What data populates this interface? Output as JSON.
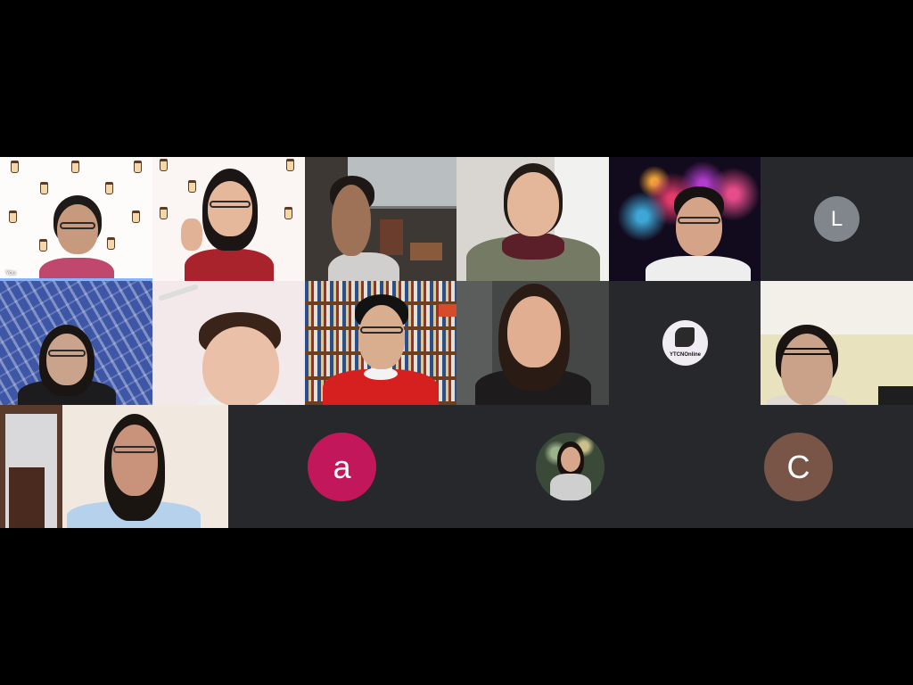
{
  "meeting": {
    "self_label": "You",
    "participants": [
      {
        "id": "p1",
        "kind": "video",
        "is_self": true
      },
      {
        "id": "p2",
        "kind": "video"
      },
      {
        "id": "p3",
        "kind": "video"
      },
      {
        "id": "p4",
        "kind": "video"
      },
      {
        "id": "p5",
        "kind": "video"
      },
      {
        "id": "p6",
        "kind": "avatar",
        "initial": "L",
        "color": "#80868b"
      },
      {
        "id": "p7",
        "kind": "video"
      },
      {
        "id": "p8",
        "kind": "video"
      },
      {
        "id": "p9",
        "kind": "video"
      },
      {
        "id": "p10",
        "kind": "video"
      },
      {
        "id": "p11",
        "kind": "avatar-image",
        "badge_text": "YTCNOnline"
      },
      {
        "id": "p12",
        "kind": "video"
      },
      {
        "id": "p13",
        "kind": "video"
      },
      {
        "id": "p14",
        "kind": "avatar",
        "initial": "a",
        "color": "#c2185b"
      },
      {
        "id": "p15",
        "kind": "avatar-image"
      },
      {
        "id": "p16",
        "kind": "avatar",
        "initial": "C",
        "color": "#795548"
      }
    ]
  }
}
